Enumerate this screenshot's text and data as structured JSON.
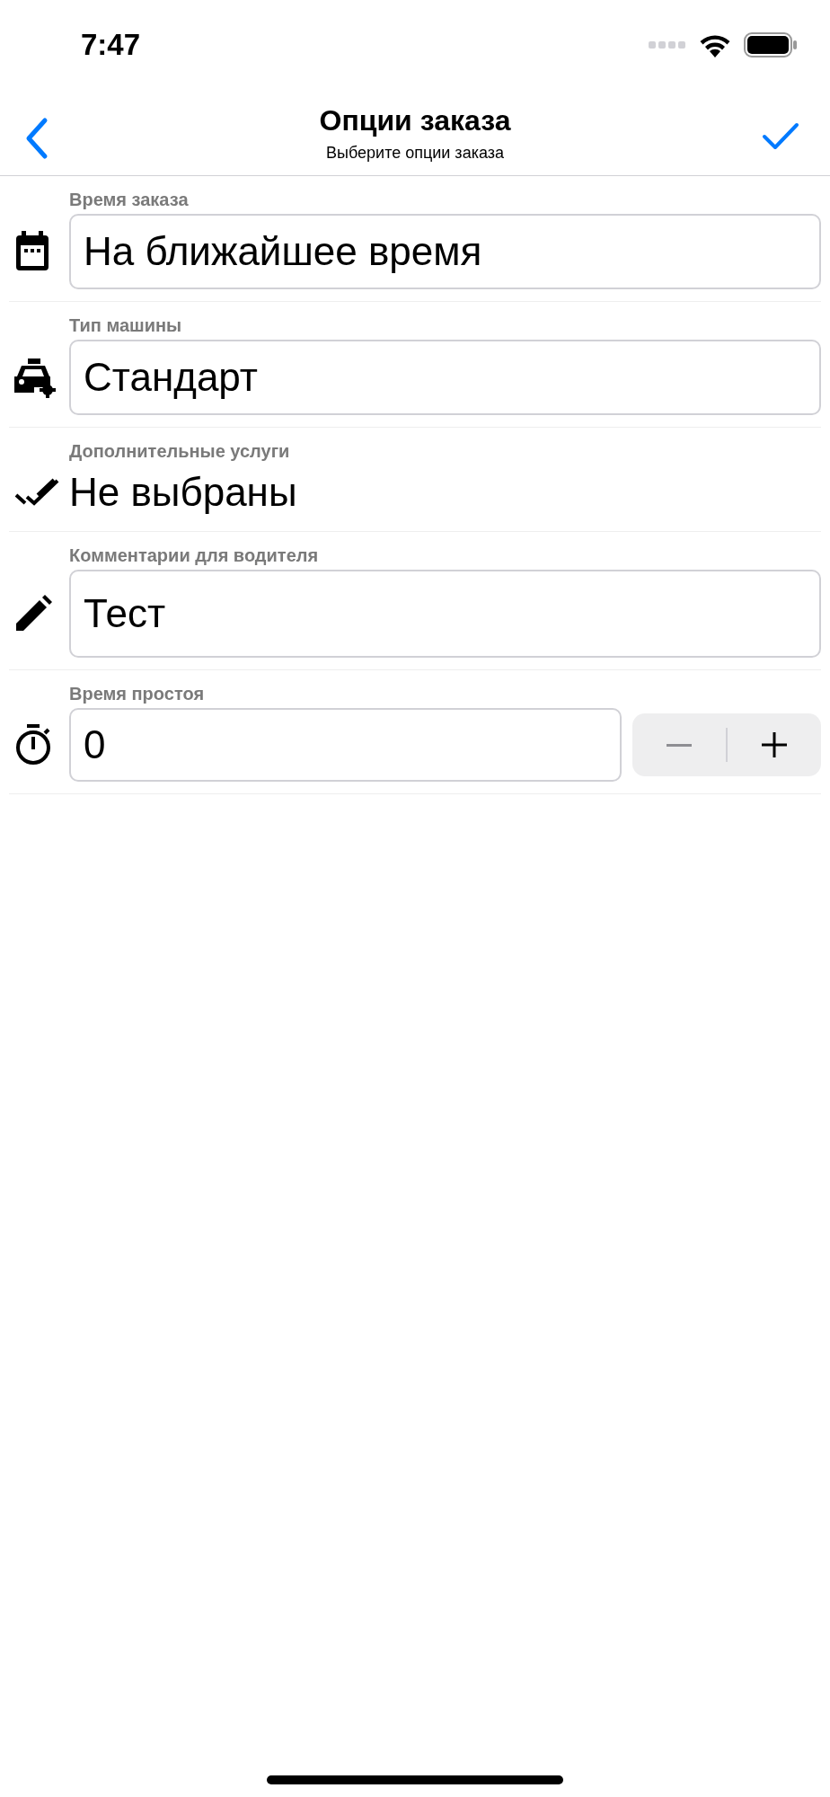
{
  "status_bar": {
    "time": "7:47"
  },
  "nav": {
    "title": "Опции заказа",
    "subtitle": "Выберите опции заказа"
  },
  "rows": [
    {
      "kind": "field",
      "label": "Время заказа",
      "value": "На ближайшее время"
    },
    {
      "kind": "field",
      "label": "Тип машины",
      "value": "Стандарт"
    },
    {
      "kind": "text",
      "label": "Дополнительные услуги",
      "value": "Не выбраны"
    },
    {
      "kind": "field",
      "label": "Комментарии для водителя",
      "value": "Тест"
    },
    {
      "kind": "stepper",
      "label": "Время простоя",
      "value": "0",
      "decrement_disabled": true,
      "increment_disabled": false
    }
  ]
}
